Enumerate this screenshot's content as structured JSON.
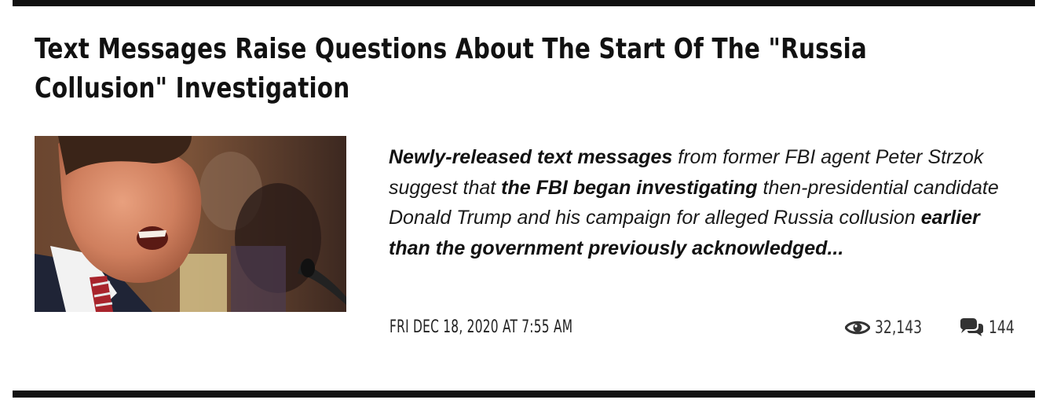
{
  "article": {
    "headline": "Text Messages Raise Questions About The Start Of The \"Russia Collusion\" Investigation",
    "summary": [
      {
        "text": "Newly-released text messages",
        "bold": true
      },
      {
        "text": " from former FBI agent Peter Strzok suggest that ",
        "bold": false
      },
      {
        "text": "the FBI began investigating",
        "bold": true
      },
      {
        "text": " then-presidential candidate Donald Trump and his campaign for alleged Russia collusion ",
        "bold": false
      },
      {
        "text": "earlier than the government previously acknowledged...",
        "bold": true
      }
    ],
    "date": "FRI DEC 18, 2020 AT 7:55 AM",
    "views": "32,143",
    "comments": "144",
    "image_alt": "Man speaking animatedly at a hearing microphone"
  },
  "icons": {
    "views": "eye-icon",
    "comments": "chat-bubbles-icon"
  },
  "colors": {
    "rule": "#111111",
    "text": "#111111",
    "meta": "#333333"
  }
}
